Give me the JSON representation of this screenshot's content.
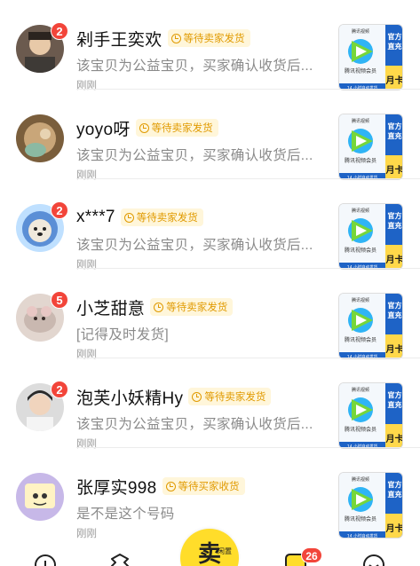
{
  "conversations": [
    {
      "name": "剁手王奕欢",
      "status": "等待卖家发货",
      "preview": "该宝贝为公益宝贝，买家确认收货后...",
      "time": "刚刚",
      "unread": "2",
      "avatar_color": "#6b5a4e"
    },
    {
      "name": "yoyo呀",
      "status": "等待卖家发货",
      "preview": "该宝贝为公益宝贝，买家确认收货后...",
      "time": "刚刚",
      "unread": "",
      "avatar_color": "#7a5e3c"
    },
    {
      "name": "x***7",
      "status": "等待卖家发货",
      "preview": "该宝贝为公益宝贝，买家确认收货后...",
      "time": "刚刚",
      "unread": "2",
      "avatar_color": "#5b8fd6"
    },
    {
      "name": "小芝甜意",
      "status": "等待卖家发货",
      "preview": "[记得及时发货]",
      "time": "刚刚",
      "unread": "5",
      "avatar_color": "#c9b8b0"
    },
    {
      "name": "泡芙小妖精Hy",
      "status": "等待卖家发货",
      "preview": "该宝贝为公益宝贝，买家确认收货后...",
      "time": "刚刚",
      "unread": "2",
      "avatar_color": "#dcdcdc"
    },
    {
      "name": "张厚实998",
      "status": "等待买家收货",
      "preview": "是不是这个号码",
      "time": "刚刚",
      "unread": "",
      "avatar_color": "#c7b8e8"
    }
  ],
  "product_thumb": {
    "brand": "腾讯视频",
    "title": "腾讯视频会员",
    "badge_top": "官方直充",
    "badge_bottom": "月卡",
    "footer": "14 小时自动发货"
  },
  "tabbar": {
    "sell_label": "卖",
    "sell_sub": "闲置",
    "messages_count": "26"
  },
  "colors": {
    "badge_red": "#f2453a",
    "status_bg": "#fff6da",
    "status_text": "#e09a00",
    "sell_yellow": "#ffdd2a"
  },
  "icons": [
    "clock-icon",
    "home-icon",
    "fish-pond-icon",
    "message-icon",
    "profile-icon"
  ]
}
